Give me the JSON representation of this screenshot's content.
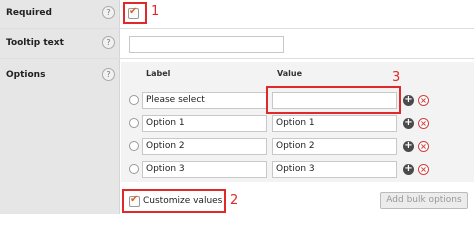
{
  "rows": {
    "required": {
      "label": "Required",
      "help": "?"
    },
    "tooltip": {
      "label": "Tooltip text",
      "help": "?",
      "value": ""
    },
    "options": {
      "label": "Options",
      "help": "?"
    }
  },
  "options_table": {
    "headers": {
      "label": "Label",
      "value": "Value"
    },
    "items": [
      {
        "label": "Please select",
        "value": ""
      },
      {
        "label": "Option 1",
        "value": "Option 1"
      },
      {
        "label": "Option 2",
        "value": "Option 2"
      },
      {
        "label": "Option 3",
        "value": "Option 3"
      }
    ]
  },
  "customize": {
    "label": "Customize values",
    "checked": true
  },
  "bulk_button": "Add bulk options",
  "annotations": [
    "1",
    "2",
    "3"
  ],
  "colors": {
    "annotation": "#e02a2a",
    "checkmark": "#e0602a"
  }
}
